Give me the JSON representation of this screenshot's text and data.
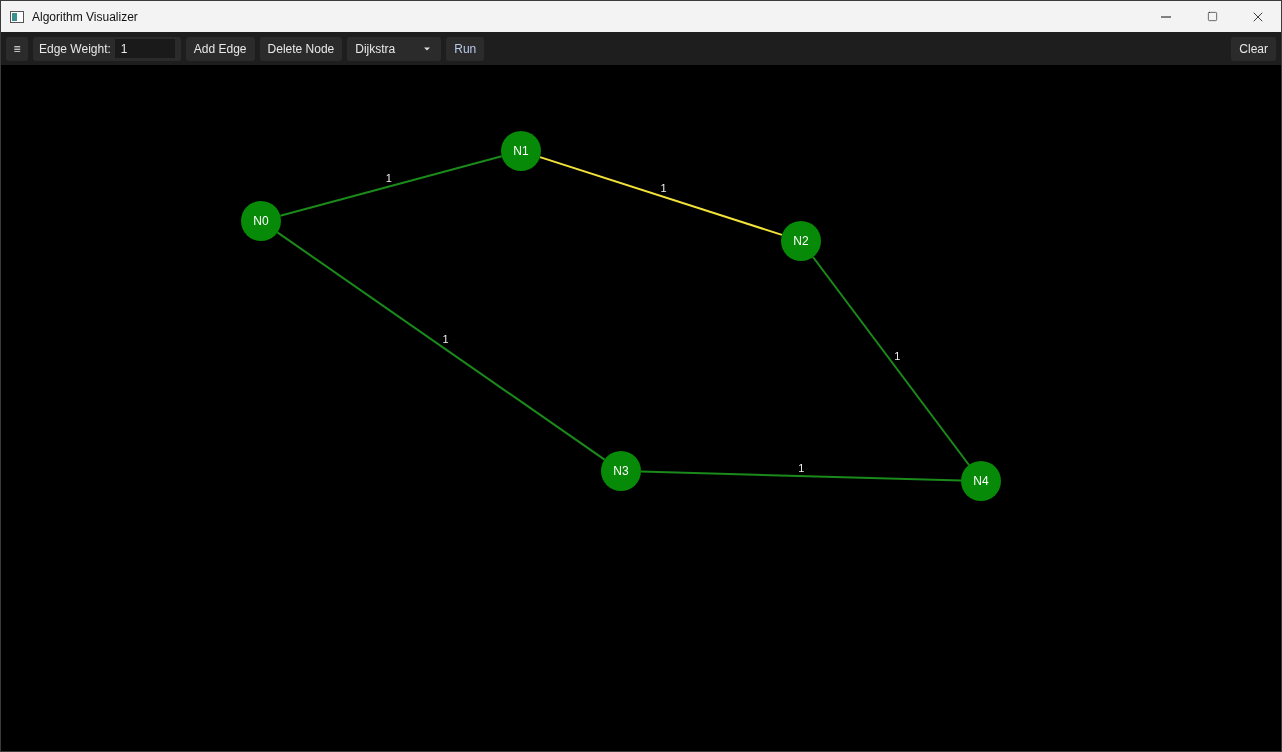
{
  "window": {
    "title": "Algorithm Visualizer"
  },
  "toolbar": {
    "menu": "≡",
    "edge_weight": {
      "label": "Edge Weight:",
      "value": "1"
    },
    "buttons": [
      "Add Edge",
      "Delete Node"
    ],
    "algorithm": "Dijkstra",
    "run": "Run",
    "clear": "Clear"
  },
  "graph": {
    "nodes": [
      {
        "label": "N0"
      },
      {
        "label": "N1"
      },
      {
        "label": "N2"
      },
      {
        "label": "N3"
      },
      {
        "label": "N4"
      }
    ],
    "edges": [
      {
        "weight": "1",
        "highlighted": false
      },
      {
        "weight": "1",
        "highlighted": true
      },
      {
        "weight": "1",
        "highlighted": false
      },
      {
        "weight": "1",
        "highlighted": false
      },
      {
        "weight": "1",
        "highlighted": false
      }
    ]
  }
}
